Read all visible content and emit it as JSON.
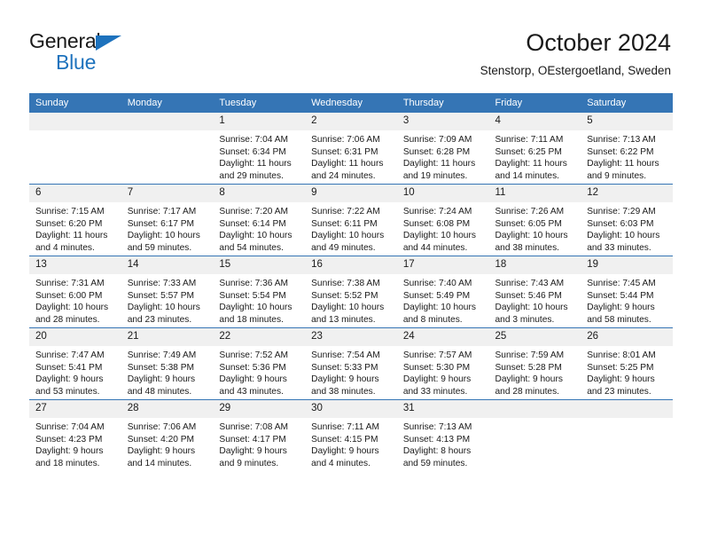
{
  "brand": {
    "name_top": "General",
    "name_bottom": "Blue",
    "triangle_color": "#1d72bd"
  },
  "header": {
    "title": "October 2024",
    "subtitle": "Stenstorp, OEstergoetland, Sweden",
    "accent_color": "#3575b5",
    "daynum_band_color": "#f0f0f0"
  },
  "calendar": {
    "weekday_headers": [
      "Sunday",
      "Monday",
      "Tuesday",
      "Wednesday",
      "Thursday",
      "Friday",
      "Saturday"
    ],
    "weeks": [
      [
        {
          "day": "",
          "empty": true,
          "sunrise": "",
          "sunset": "",
          "daylight_1": "",
          "daylight_2": ""
        },
        {
          "day": "",
          "empty": true,
          "sunrise": "",
          "sunset": "",
          "daylight_1": "",
          "daylight_2": ""
        },
        {
          "day": "1",
          "sunrise": "Sunrise: 7:04 AM",
          "sunset": "Sunset: 6:34 PM",
          "daylight_1": "Daylight: 11 hours",
          "daylight_2": "and 29 minutes."
        },
        {
          "day": "2",
          "sunrise": "Sunrise: 7:06 AM",
          "sunset": "Sunset: 6:31 PM",
          "daylight_1": "Daylight: 11 hours",
          "daylight_2": "and 24 minutes."
        },
        {
          "day": "3",
          "sunrise": "Sunrise: 7:09 AM",
          "sunset": "Sunset: 6:28 PM",
          "daylight_1": "Daylight: 11 hours",
          "daylight_2": "and 19 minutes."
        },
        {
          "day": "4",
          "sunrise": "Sunrise: 7:11 AM",
          "sunset": "Sunset: 6:25 PM",
          "daylight_1": "Daylight: 11 hours",
          "daylight_2": "and 14 minutes."
        },
        {
          "day": "5",
          "sunrise": "Sunrise: 7:13 AM",
          "sunset": "Sunset: 6:22 PM",
          "daylight_1": "Daylight: 11 hours",
          "daylight_2": "and 9 minutes."
        }
      ],
      [
        {
          "day": "6",
          "sunrise": "Sunrise: 7:15 AM",
          "sunset": "Sunset: 6:20 PM",
          "daylight_1": "Daylight: 11 hours",
          "daylight_2": "and 4 minutes."
        },
        {
          "day": "7",
          "sunrise": "Sunrise: 7:17 AM",
          "sunset": "Sunset: 6:17 PM",
          "daylight_1": "Daylight: 10 hours",
          "daylight_2": "and 59 minutes."
        },
        {
          "day": "8",
          "sunrise": "Sunrise: 7:20 AM",
          "sunset": "Sunset: 6:14 PM",
          "daylight_1": "Daylight: 10 hours",
          "daylight_2": "and 54 minutes."
        },
        {
          "day": "9",
          "sunrise": "Sunrise: 7:22 AM",
          "sunset": "Sunset: 6:11 PM",
          "daylight_1": "Daylight: 10 hours",
          "daylight_2": "and 49 minutes."
        },
        {
          "day": "10",
          "sunrise": "Sunrise: 7:24 AM",
          "sunset": "Sunset: 6:08 PM",
          "daylight_1": "Daylight: 10 hours",
          "daylight_2": "and 44 minutes."
        },
        {
          "day": "11",
          "sunrise": "Sunrise: 7:26 AM",
          "sunset": "Sunset: 6:05 PM",
          "daylight_1": "Daylight: 10 hours",
          "daylight_2": "and 38 minutes."
        },
        {
          "day": "12",
          "sunrise": "Sunrise: 7:29 AM",
          "sunset": "Sunset: 6:03 PM",
          "daylight_1": "Daylight: 10 hours",
          "daylight_2": "and 33 minutes."
        }
      ],
      [
        {
          "day": "13",
          "sunrise": "Sunrise: 7:31 AM",
          "sunset": "Sunset: 6:00 PM",
          "daylight_1": "Daylight: 10 hours",
          "daylight_2": "and 28 minutes."
        },
        {
          "day": "14",
          "sunrise": "Sunrise: 7:33 AM",
          "sunset": "Sunset: 5:57 PM",
          "daylight_1": "Daylight: 10 hours",
          "daylight_2": "and 23 minutes."
        },
        {
          "day": "15",
          "sunrise": "Sunrise: 7:36 AM",
          "sunset": "Sunset: 5:54 PM",
          "daylight_1": "Daylight: 10 hours",
          "daylight_2": "and 18 minutes."
        },
        {
          "day": "16",
          "sunrise": "Sunrise: 7:38 AM",
          "sunset": "Sunset: 5:52 PM",
          "daylight_1": "Daylight: 10 hours",
          "daylight_2": "and 13 minutes."
        },
        {
          "day": "17",
          "sunrise": "Sunrise: 7:40 AM",
          "sunset": "Sunset: 5:49 PM",
          "daylight_1": "Daylight: 10 hours",
          "daylight_2": "and 8 minutes."
        },
        {
          "day": "18",
          "sunrise": "Sunrise: 7:43 AM",
          "sunset": "Sunset: 5:46 PM",
          "daylight_1": "Daylight: 10 hours",
          "daylight_2": "and 3 minutes."
        },
        {
          "day": "19",
          "sunrise": "Sunrise: 7:45 AM",
          "sunset": "Sunset: 5:44 PM",
          "daylight_1": "Daylight: 9 hours",
          "daylight_2": "and 58 minutes."
        }
      ],
      [
        {
          "day": "20",
          "sunrise": "Sunrise: 7:47 AM",
          "sunset": "Sunset: 5:41 PM",
          "daylight_1": "Daylight: 9 hours",
          "daylight_2": "and 53 minutes."
        },
        {
          "day": "21",
          "sunrise": "Sunrise: 7:49 AM",
          "sunset": "Sunset: 5:38 PM",
          "daylight_1": "Daylight: 9 hours",
          "daylight_2": "and 48 minutes."
        },
        {
          "day": "22",
          "sunrise": "Sunrise: 7:52 AM",
          "sunset": "Sunset: 5:36 PM",
          "daylight_1": "Daylight: 9 hours",
          "daylight_2": "and 43 minutes."
        },
        {
          "day": "23",
          "sunrise": "Sunrise: 7:54 AM",
          "sunset": "Sunset: 5:33 PM",
          "daylight_1": "Daylight: 9 hours",
          "daylight_2": "and 38 minutes."
        },
        {
          "day": "24",
          "sunrise": "Sunrise: 7:57 AM",
          "sunset": "Sunset: 5:30 PM",
          "daylight_1": "Daylight: 9 hours",
          "daylight_2": "and 33 minutes."
        },
        {
          "day": "25",
          "sunrise": "Sunrise: 7:59 AM",
          "sunset": "Sunset: 5:28 PM",
          "daylight_1": "Daylight: 9 hours",
          "daylight_2": "and 28 minutes."
        },
        {
          "day": "26",
          "sunrise": "Sunrise: 8:01 AM",
          "sunset": "Sunset: 5:25 PM",
          "daylight_1": "Daylight: 9 hours",
          "daylight_2": "and 23 minutes."
        }
      ],
      [
        {
          "day": "27",
          "sunrise": "Sunrise: 7:04 AM",
          "sunset": "Sunset: 4:23 PM",
          "daylight_1": "Daylight: 9 hours",
          "daylight_2": "and 18 minutes."
        },
        {
          "day": "28",
          "sunrise": "Sunrise: 7:06 AM",
          "sunset": "Sunset: 4:20 PM",
          "daylight_1": "Daylight: 9 hours",
          "daylight_2": "and 14 minutes."
        },
        {
          "day": "29",
          "sunrise": "Sunrise: 7:08 AM",
          "sunset": "Sunset: 4:17 PM",
          "daylight_1": "Daylight: 9 hours",
          "daylight_2": "and 9 minutes."
        },
        {
          "day": "30",
          "sunrise": "Sunrise: 7:11 AM",
          "sunset": "Sunset: 4:15 PM",
          "daylight_1": "Daylight: 9 hours",
          "daylight_2": "and 4 minutes."
        },
        {
          "day": "31",
          "sunrise": "Sunrise: 7:13 AM",
          "sunset": "Sunset: 4:13 PM",
          "daylight_1": "Daylight: 8 hours",
          "daylight_2": "and 59 minutes."
        },
        {
          "day": "",
          "empty": true,
          "sunrise": "",
          "sunset": "",
          "daylight_1": "",
          "daylight_2": ""
        },
        {
          "day": "",
          "empty": true,
          "sunrise": "",
          "sunset": "",
          "daylight_1": "",
          "daylight_2": ""
        }
      ]
    ]
  }
}
